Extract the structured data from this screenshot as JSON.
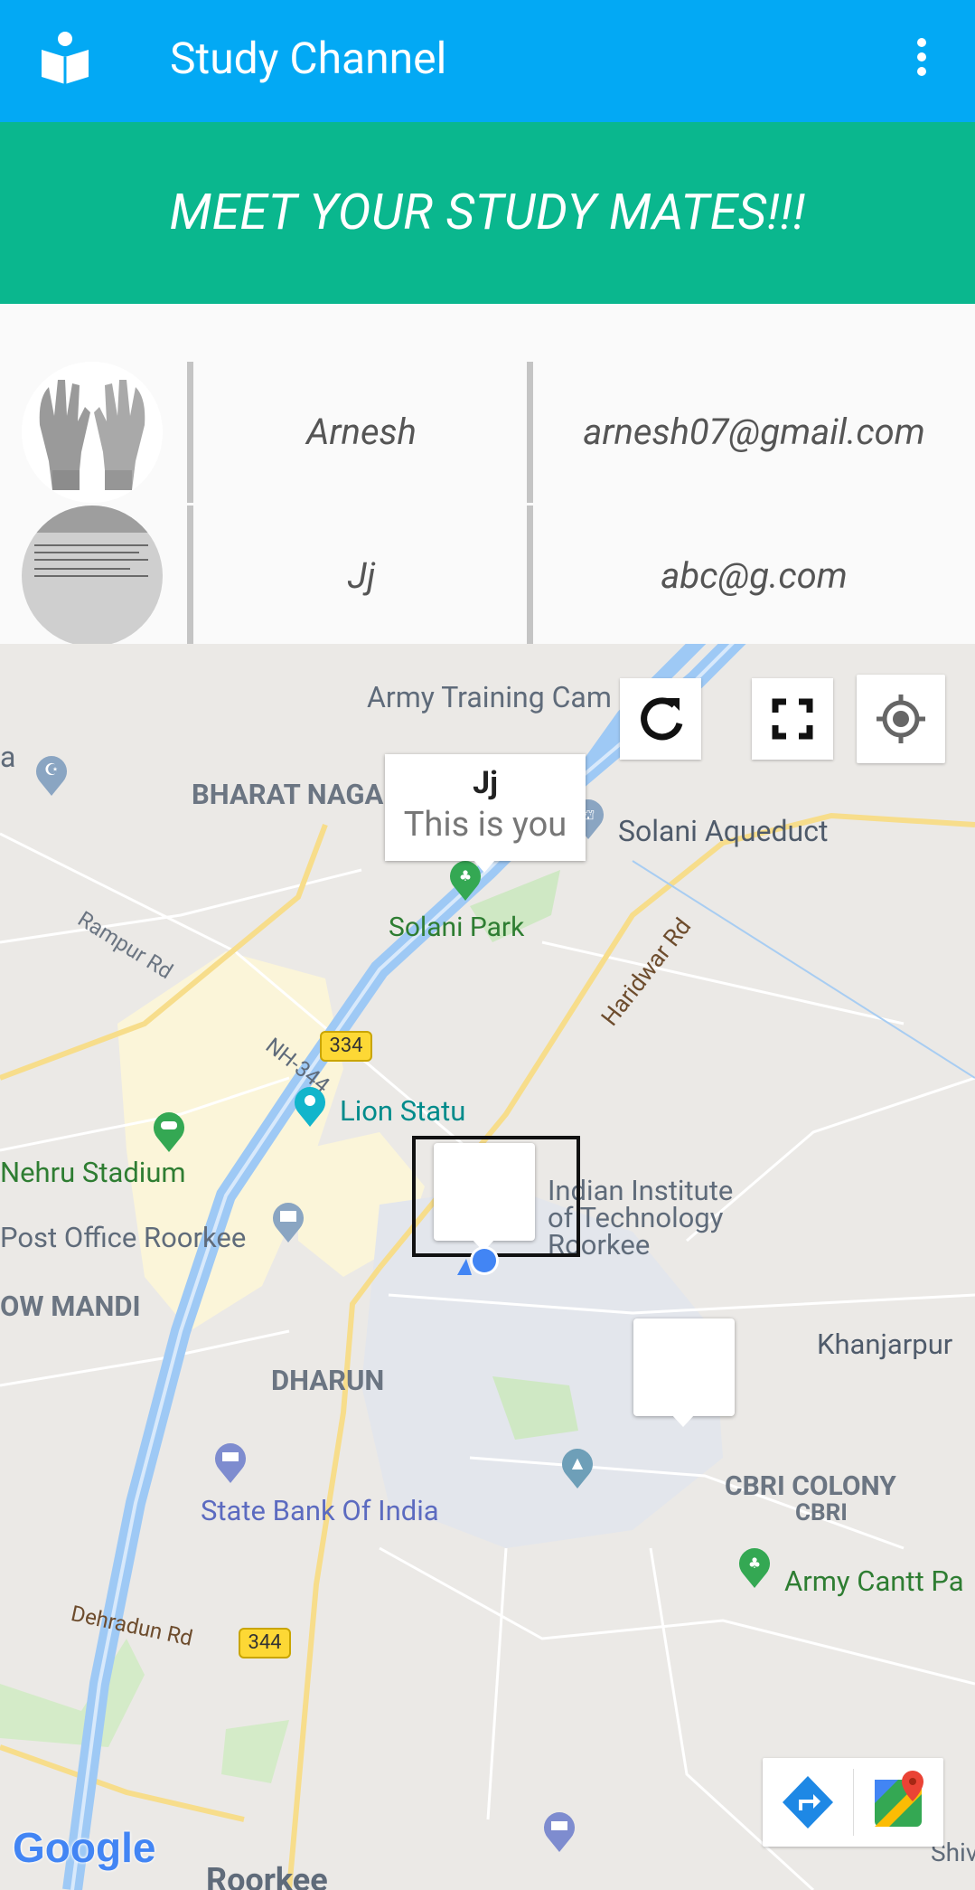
{
  "appbar": {
    "title": "Study Channel",
    "icon": "reading-person-icon",
    "menu_icon": "more-vert-icon",
    "color": "#03a9f4"
  },
  "banner": {
    "text": "MEET YOUR STUDY MATES!!!",
    "color": "#0ab78e"
  },
  "mates": [
    {
      "name": "Arnesh",
      "email": "arnesh07@gmail.com",
      "avatar": "gloves-photo"
    },
    {
      "name": "Jj",
      "email": "abc@g.com",
      "avatar": "document-photo"
    }
  ],
  "map": {
    "controls": {
      "refresh_icon": "refresh-icon",
      "fullscreen_icon": "fullscreen-icon",
      "location_icon": "my-location-icon"
    },
    "info_window": {
      "title": "Jj",
      "snippet": "This is you"
    },
    "labels": {
      "army_training": "Army Training Cam",
      "bharat_nagar": "BHARAT NAGAR",
      "solani_aqueduct": "Solani Aqueduct",
      "rampur_rd": "Rampur Rd",
      "solani_park": "Solani Park",
      "haridwar_rd": "Haridwar Rd",
      "nh344": "NH-344",
      "lion_statue": "Lion Statu",
      "nehru_stadium": "Nehru Stadium",
      "iit_line1": "Indian Institute",
      "iit_line2": "of Technology",
      "iit_line3": "Roorkee",
      "post_office": "Post Office Roorkee",
      "ow_mandi": "OW MANDI",
      "shield_334": "334",
      "khanjarpur": "Khanjarpur",
      "dharun": "DHARUN",
      "cbri_colony": "CBRI COLONY",
      "cbri": "CBRI",
      "sbi": "State Bank Of India",
      "army_cantt": "Army Cantt Pa",
      "dehradun_rd": "Dehradun Rd",
      "shield_344": "344",
      "roorkee": "Roorkee",
      "shiv": "Shiv",
      "left_a": "a"
    },
    "google_logo": "Google",
    "bottom_controls": {
      "directions_icon": "directions-icon",
      "maps_icon": "google-maps-icon"
    }
  }
}
